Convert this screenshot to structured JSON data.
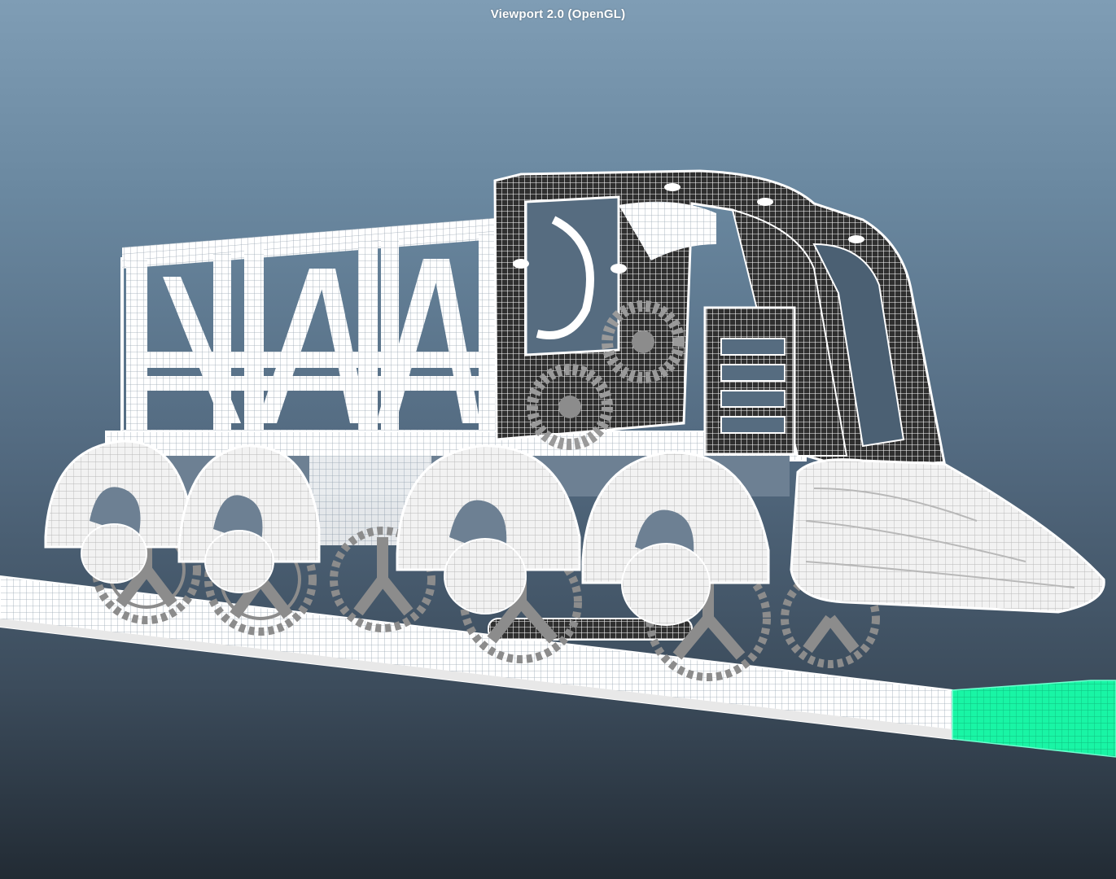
{
  "viewport": {
    "title": "Viewport 2.0 (OpenGL)"
  },
  "scene": {
    "model": "wireframe-locomotive",
    "selected_object": "track-end-segment",
    "colors": {
      "background_top": "#7f9db5",
      "background_bottom": "#222b34",
      "wireframe": "#ffffff",
      "selection_highlight": "#19f5a5",
      "shaded_dark": "#3a3a3a",
      "shaded_gray": "#8c8c8c"
    }
  }
}
